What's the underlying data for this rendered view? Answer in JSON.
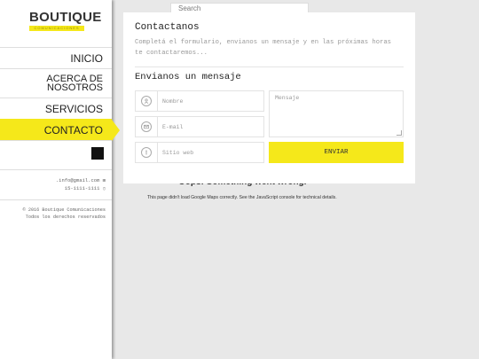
{
  "brand": {
    "name": "BOUTIQUE",
    "tagline": "COMUNICACIONES"
  },
  "nav": {
    "items": [
      {
        "label": "INICIO"
      },
      {
        "label_line1": "ACERCA DE",
        "label_line2": "NOSOTROS"
      },
      {
        "label": "SERVICIOS"
      },
      {
        "label": "CONTACTO"
      }
    ],
    "active": "CONTACTO"
  },
  "social": {
    "icon": "instagram-icon",
    "glyph": ""
  },
  "contact": {
    "email": ".info@gmail.com",
    "email_icon": "⊞",
    "phone": "15-1111-1111",
    "phone_icon": "▯"
  },
  "footer": {
    "line1": "© 2016 Boutique Comunicaciones",
    "line2": "Todos los derechos reservados"
  },
  "map": {
    "search_value": "Search",
    "error_title": "Oops! Something went wrong.",
    "error_text": "This page didn't load Google Maps correctly. See the JavaScript console for technical details."
  },
  "form": {
    "title": "Contactanos",
    "description": "Completá el formulario, envianos un mensaje y en las próximas horas te contactaremos...",
    "subtitle": "Envianos un mensaje",
    "name_placeholder": "Nombre",
    "email_placeholder": "E-mail",
    "website_placeholder": "Sitio web",
    "message_placeholder": "Mensaje",
    "submit_label": "ENVIAR",
    "icons": {
      "name": "user-icon",
      "email": "email-icon",
      "website": "globe-icon"
    }
  },
  "colors": {
    "accent": "#f5e81a",
    "background": "#e8e8e8",
    "sidebar": "#ffffff",
    "text": "#222222"
  }
}
